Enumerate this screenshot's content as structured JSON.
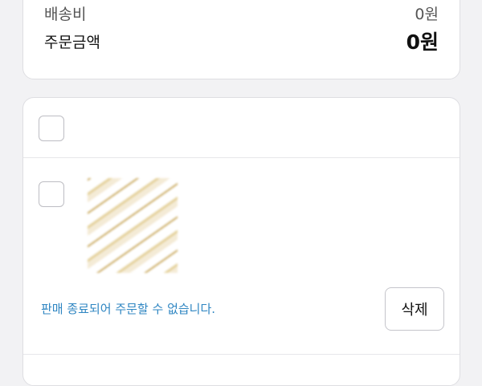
{
  "summary": {
    "shipping_label": "배송비",
    "shipping_value": "0원",
    "total_label": "주문금액",
    "total_value": "0원"
  },
  "cart": {
    "seller_name": "",
    "item": {
      "product_name": "",
      "status_text": "판매 종료되어 주문할 수 없습니다.",
      "delete_label": "삭제"
    }
  },
  "colors": {
    "status_text": "#2f86c2",
    "background": "#f2f2f4",
    "card": "#ffffff"
  }
}
